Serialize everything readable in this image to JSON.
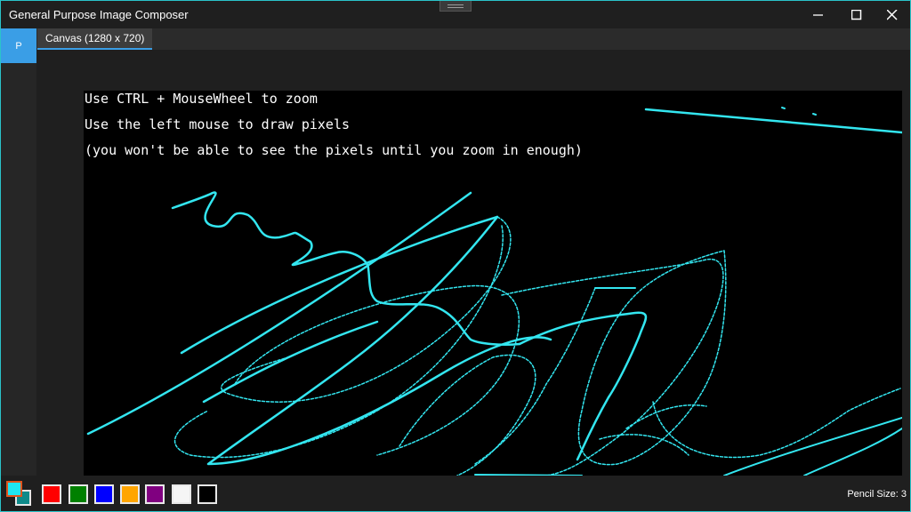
{
  "window": {
    "title": "General Purpose Image Composer",
    "border_color": "#2ac3c9"
  },
  "controls": {
    "minimize_icon": "minimize-icon",
    "maximize_icon": "maximize-icon",
    "close_icon": "close-icon"
  },
  "app_button": {
    "label": "P",
    "color": "#3a9ee6"
  },
  "tabs": [
    {
      "label": "Canvas (1280 x 720)",
      "active": true
    }
  ],
  "canvas": {
    "background": "#000000",
    "stroke_color": "#33e6f0",
    "instructions": [
      "Use CTRL + MouseWheel to zoom",
      "Use the left mouse to draw pixels",
      "(you won't be able to see the pixels until you zoom in enough)"
    ]
  },
  "palette": {
    "primary": "#1ee6f2",
    "secondary": "#0e8a8a",
    "primary_border": "#e0541e",
    "swatches": [
      {
        "name": "red",
        "color": "#ff0000"
      },
      {
        "name": "green",
        "color": "#008000"
      },
      {
        "name": "blue",
        "color": "#0000ff"
      },
      {
        "name": "orange",
        "color": "#ffa500"
      },
      {
        "name": "purple",
        "color": "#800080"
      },
      {
        "name": "white",
        "color": "#f5f5f5"
      },
      {
        "name": "black",
        "color": "#000000"
      }
    ]
  },
  "status": {
    "pencil_size": "Pencil Size: 3"
  }
}
